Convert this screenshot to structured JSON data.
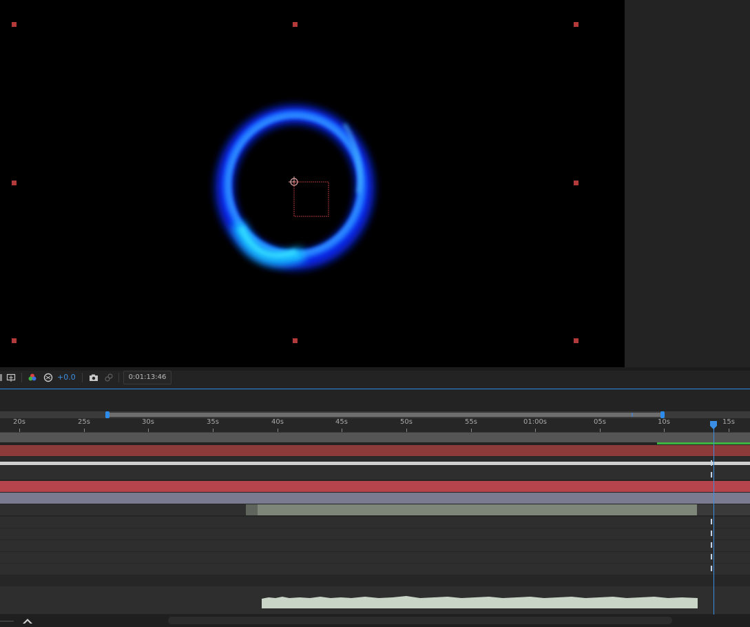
{
  "toolbar": {
    "exposure_value": "+0.0",
    "timecode": "0:01:13:46",
    "icons": [
      "region-of-interest-icon",
      "color-channels-icon",
      "reset-exposure-icon",
      "snapshot-icon",
      "show-snapshot-icon"
    ]
  },
  "ruler": {
    "labels": [
      "20s",
      "25s",
      "30s",
      "35s",
      "40s",
      "45s",
      "50s",
      "55s",
      "01:00s",
      "05s",
      "10s",
      "15s"
    ]
  },
  "colors": {
    "accent": "#2d8ceb",
    "ring": "#1e5bff",
    "layer_red": "#8c3a3a",
    "layer_pink": "#b5444c",
    "layer_lavender": "#7a7a91",
    "work_area_green": "#3fb43f"
  }
}
